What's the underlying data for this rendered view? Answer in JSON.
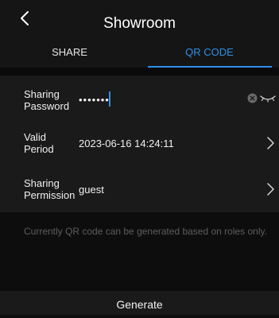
{
  "header": {
    "title": "Showroom"
  },
  "tabs": [
    {
      "label": "SHARE",
      "active": false
    },
    {
      "label": "QR CODE",
      "active": true
    }
  ],
  "form": {
    "password": {
      "label": "Sharing Password",
      "value": "•••••••"
    },
    "valid_period": {
      "label": "Valid Period",
      "value": "2023-06-16 14:24:11"
    },
    "permission": {
      "label": "Sharing Permission",
      "value": "guest"
    }
  },
  "note": "Currently QR code can be generated based on roles only.",
  "footer": {
    "generate_label": "Generate"
  },
  "colors": {
    "accent": "#2f8fe8",
    "background": "#0d0d0d",
    "panel": "#1a1a1a",
    "muted_text": "#5e5e5e"
  },
  "icons": {
    "back": "chevron-left-icon",
    "clear": "clear-circle-icon",
    "visibility": "eye-closed-icon",
    "arrow": "chevron-right-icon"
  }
}
